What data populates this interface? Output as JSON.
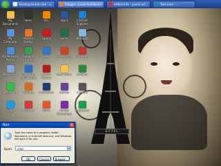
{
  "taskbar": {
    "tasks": [
      {
        "label": "Tuesdaymarket.com - a...",
        "color": "#e8e8e8"
      },
      {
        "label": "Blogger: yuniar-dashboard - ...",
        "color": "#f07b2a"
      },
      {
        "label": "Artikel-Info - yuniar-art...",
        "color": "#c0392b"
      },
      {
        "label": "Tulis Entri - ...",
        "color": "#2980b9"
      }
    ]
  },
  "desktop_icons": [
    {
      "label": "My Documents",
      "icon": "folder-icon",
      "color": "#f0c14b"
    },
    {
      "label": "My Computer",
      "icon": "computer-icon",
      "color": "#5d8fd6"
    },
    {
      "label": "My Network Places",
      "icon": "network-icon",
      "color": "#4a90d9"
    },
    {
      "label": "Recycle Bin",
      "icon": "recycle-bin-icon",
      "color": "#7fa7d8"
    },
    {
      "label": "WhatsApp",
      "icon": "chat-icon",
      "color": "#2fbf4a"
    },
    {
      "label": "Skype",
      "icon": "skype-icon",
      "color": "#1d9be0"
    },
    {
      "label": "Nero",
      "icon": "disc-icon",
      "color": "#333333"
    },
    {
      "label": "Mozilla Firefox",
      "icon": "firefox-icon",
      "color": "#e5762a"
    },
    {
      "label": "Google Chrome",
      "icon": "chrome-icon",
      "color": "#3a9d4f"
    },
    {
      "label": "Cyberlink Media Suite",
      "icon": "media-icon",
      "color": "#2a6fc9"
    },
    {
      "label": "Winamp",
      "icon": "music-icon",
      "color": "#d96b1d"
    },
    {
      "label": "Picasa 3",
      "icon": "photo-icon",
      "color": "#d43b3b"
    },
    {
      "label": "VLC",
      "icon": "cone-icon",
      "color": "#f08a00"
    },
    {
      "label": "Opera",
      "icon": "opera-icon",
      "color": "#cc1b1b"
    },
    {
      "label": "IDM",
      "icon": "download-icon",
      "color": "#2f79c5"
    },
    {
      "label": "Adobe Reader",
      "icon": "pdf-icon",
      "color": "#b51d1d"
    },
    {
      "label": "Photoshop",
      "icon": "ps-icon",
      "color": "#1f3c73"
    },
    {
      "label": "Office",
      "icon": "office-icon",
      "color": "#e2572a"
    },
    {
      "label": "Word",
      "icon": "word-icon",
      "color": "#2a5699"
    },
    {
      "label": "Excel",
      "icon": "excel-icon",
      "color": "#1f7244"
    },
    {
      "label": "PowerPoint",
      "icon": "ppt-icon",
      "color": "#c9461f"
    },
    {
      "label": "New Folder",
      "icon": "folder-icon",
      "color": "#f0c14b"
    },
    {
      "label": "Games",
      "icon": "game-icon",
      "color": "#6b3fa0"
    },
    {
      "label": "Yahoo! Messenger",
      "icon": "messenger-icon",
      "color": "#7b2ea8"
    },
    {
      "label": "Internet Explorer",
      "icon": "ie-icon",
      "color": "#1e7fd6"
    },
    {
      "label": "Notepad",
      "icon": "notepad-icon",
      "color": "#87b4de"
    },
    {
      "label": "CCleaner",
      "icon": "cleaner-icon",
      "color": "#c0392b"
    },
    {
      "label": "Smadav",
      "icon": "shield-icon",
      "color": "#2b8a3e"
    },
    {
      "label": "Camera",
      "icon": "camera-icon",
      "color": "#555555"
    },
    {
      "label": "Kaspersky",
      "icon": "antivirus-icon",
      "color": "#1b9e4b"
    },
    {
      "label": "Team Viewer",
      "icon": "remote-icon",
      "color": "#0e6bb8"
    },
    {
      "label": "Folder",
      "icon": "folder-icon",
      "color": "#f0c14b"
    },
    {
      "label": "Folder",
      "icon": "folder-icon",
      "color": "#f0c14b"
    },
    {
      "label": "Media Player",
      "icon": "play-icon",
      "color": "#e06a1b"
    },
    {
      "label": "Calculator",
      "icon": "calculator-icon",
      "color": "#6b7a8f"
    },
    {
      "label": "Shortcut",
      "icon": "shortcut-icon",
      "color": "#4f9a34"
    }
  ],
  "wallpaper": {
    "tower_label": "EIFFEL"
  },
  "run_dialog": {
    "title": "Run",
    "close": "×",
    "description": "Type the name of a program, folder, document, or Internet resource, and Windows will open it for you.",
    "open_label": "Open:",
    "open_value": "cmd",
    "ok": "OK",
    "cancel": "Cancel",
    "browse": "Browse..."
  }
}
